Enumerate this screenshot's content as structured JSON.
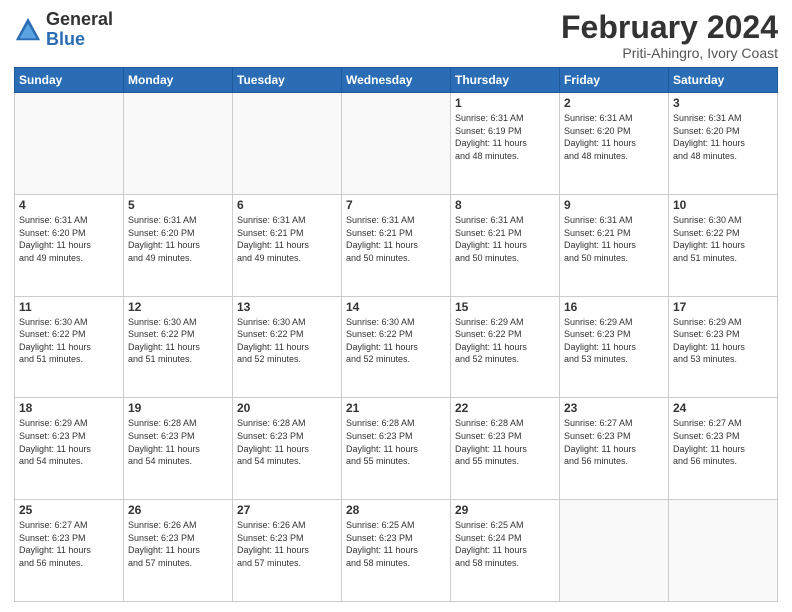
{
  "logo": {
    "general": "General",
    "blue": "Blue"
  },
  "header": {
    "month": "February 2024",
    "location": "Priti-Ahingro, Ivory Coast"
  },
  "weekdays": [
    "Sunday",
    "Monday",
    "Tuesday",
    "Wednesday",
    "Thursday",
    "Friday",
    "Saturday"
  ],
  "weeks": [
    [
      {
        "day": "",
        "info": ""
      },
      {
        "day": "",
        "info": ""
      },
      {
        "day": "",
        "info": ""
      },
      {
        "day": "",
        "info": ""
      },
      {
        "day": "1",
        "info": "Sunrise: 6:31 AM\nSunset: 6:19 PM\nDaylight: 11 hours\nand 48 minutes."
      },
      {
        "day": "2",
        "info": "Sunrise: 6:31 AM\nSunset: 6:20 PM\nDaylight: 11 hours\nand 48 minutes."
      },
      {
        "day": "3",
        "info": "Sunrise: 6:31 AM\nSunset: 6:20 PM\nDaylight: 11 hours\nand 48 minutes."
      }
    ],
    [
      {
        "day": "4",
        "info": "Sunrise: 6:31 AM\nSunset: 6:20 PM\nDaylight: 11 hours\nand 49 minutes."
      },
      {
        "day": "5",
        "info": "Sunrise: 6:31 AM\nSunset: 6:20 PM\nDaylight: 11 hours\nand 49 minutes."
      },
      {
        "day": "6",
        "info": "Sunrise: 6:31 AM\nSunset: 6:21 PM\nDaylight: 11 hours\nand 49 minutes."
      },
      {
        "day": "7",
        "info": "Sunrise: 6:31 AM\nSunset: 6:21 PM\nDaylight: 11 hours\nand 50 minutes."
      },
      {
        "day": "8",
        "info": "Sunrise: 6:31 AM\nSunset: 6:21 PM\nDaylight: 11 hours\nand 50 minutes."
      },
      {
        "day": "9",
        "info": "Sunrise: 6:31 AM\nSunset: 6:21 PM\nDaylight: 11 hours\nand 50 minutes."
      },
      {
        "day": "10",
        "info": "Sunrise: 6:30 AM\nSunset: 6:22 PM\nDaylight: 11 hours\nand 51 minutes."
      }
    ],
    [
      {
        "day": "11",
        "info": "Sunrise: 6:30 AM\nSunset: 6:22 PM\nDaylight: 11 hours\nand 51 minutes."
      },
      {
        "day": "12",
        "info": "Sunrise: 6:30 AM\nSunset: 6:22 PM\nDaylight: 11 hours\nand 51 minutes."
      },
      {
        "day": "13",
        "info": "Sunrise: 6:30 AM\nSunset: 6:22 PM\nDaylight: 11 hours\nand 52 minutes."
      },
      {
        "day": "14",
        "info": "Sunrise: 6:30 AM\nSunset: 6:22 PM\nDaylight: 11 hours\nand 52 minutes."
      },
      {
        "day": "15",
        "info": "Sunrise: 6:29 AM\nSunset: 6:22 PM\nDaylight: 11 hours\nand 52 minutes."
      },
      {
        "day": "16",
        "info": "Sunrise: 6:29 AM\nSunset: 6:23 PM\nDaylight: 11 hours\nand 53 minutes."
      },
      {
        "day": "17",
        "info": "Sunrise: 6:29 AM\nSunset: 6:23 PM\nDaylight: 11 hours\nand 53 minutes."
      }
    ],
    [
      {
        "day": "18",
        "info": "Sunrise: 6:29 AM\nSunset: 6:23 PM\nDaylight: 11 hours\nand 54 minutes."
      },
      {
        "day": "19",
        "info": "Sunrise: 6:28 AM\nSunset: 6:23 PM\nDaylight: 11 hours\nand 54 minutes."
      },
      {
        "day": "20",
        "info": "Sunrise: 6:28 AM\nSunset: 6:23 PM\nDaylight: 11 hours\nand 54 minutes."
      },
      {
        "day": "21",
        "info": "Sunrise: 6:28 AM\nSunset: 6:23 PM\nDaylight: 11 hours\nand 55 minutes."
      },
      {
        "day": "22",
        "info": "Sunrise: 6:28 AM\nSunset: 6:23 PM\nDaylight: 11 hours\nand 55 minutes."
      },
      {
        "day": "23",
        "info": "Sunrise: 6:27 AM\nSunset: 6:23 PM\nDaylight: 11 hours\nand 56 minutes."
      },
      {
        "day": "24",
        "info": "Sunrise: 6:27 AM\nSunset: 6:23 PM\nDaylight: 11 hours\nand 56 minutes."
      }
    ],
    [
      {
        "day": "25",
        "info": "Sunrise: 6:27 AM\nSunset: 6:23 PM\nDaylight: 11 hours\nand 56 minutes."
      },
      {
        "day": "26",
        "info": "Sunrise: 6:26 AM\nSunset: 6:23 PM\nDaylight: 11 hours\nand 57 minutes."
      },
      {
        "day": "27",
        "info": "Sunrise: 6:26 AM\nSunset: 6:23 PM\nDaylight: 11 hours\nand 57 minutes."
      },
      {
        "day": "28",
        "info": "Sunrise: 6:25 AM\nSunset: 6:23 PM\nDaylight: 11 hours\nand 58 minutes."
      },
      {
        "day": "29",
        "info": "Sunrise: 6:25 AM\nSunset: 6:24 PM\nDaylight: 11 hours\nand 58 minutes."
      },
      {
        "day": "",
        "info": ""
      },
      {
        "day": "",
        "info": ""
      }
    ]
  ]
}
